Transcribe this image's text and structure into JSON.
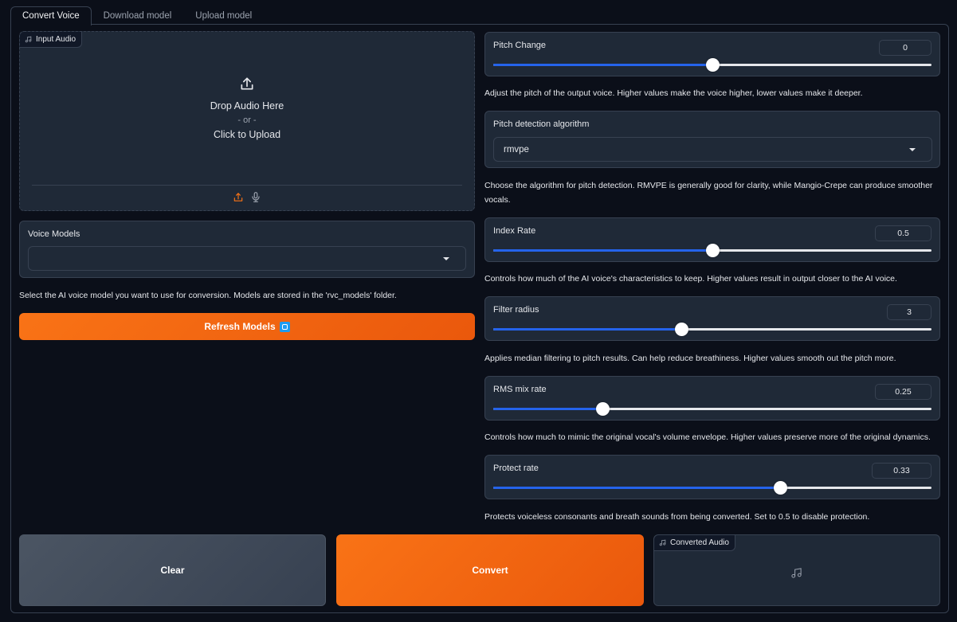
{
  "tabs": [
    {
      "label": "Convert Voice",
      "active": true
    },
    {
      "label": "Download model",
      "active": false
    },
    {
      "label": "Upload model",
      "active": false
    }
  ],
  "input_audio": {
    "label": "Input Audio",
    "label_icon": "music-note-icon",
    "drop_text": "Drop Audio Here",
    "or_text": "- or -",
    "click_text": "Click to Upload",
    "sources": [
      {
        "name": "upload-source",
        "icon": "upload-icon",
        "color": "#f97316"
      },
      {
        "name": "microphone-source",
        "icon": "microphone-icon",
        "color": "#9ca3af"
      }
    ]
  },
  "voice_models": {
    "label": "Voice Models",
    "value": "",
    "info": "Select the AI voice model you want to use for conversion. Models are stored in the 'rvc_models' folder."
  },
  "refresh_button": {
    "label": "Refresh Models",
    "emoji": "repeat-emoji-icon"
  },
  "pitch_change": {
    "label": "Pitch Change",
    "value": "0",
    "fraction": 0.5,
    "info": "Adjust the pitch of the output voice. Higher values make the voice higher, lower values make it deeper."
  },
  "pitch_algorithm": {
    "label": "Pitch detection algorithm",
    "value": "rmvpe",
    "info": "Choose the algorithm for pitch detection. RMVPE is generally good for clarity, while Mangio-Crepe can produce smoother vocals."
  },
  "index_rate": {
    "label": "Index Rate",
    "value": "0.5",
    "fraction": 0.5,
    "info": "Controls how much of the AI voice's characteristics to keep. Higher values result in output closer to the AI voice."
  },
  "filter_radius": {
    "label": "Filter radius",
    "value": "3",
    "fraction": 0.43,
    "info": "Applies median filtering to pitch results. Can help reduce breathiness. Higher values smooth out the pitch more."
  },
  "rms_mix_rate": {
    "label": "RMS mix rate",
    "value": "0.25",
    "fraction": 0.25,
    "info": "Controls how much to mimic the original vocal's volume envelope. Higher values preserve more of the original dynamics."
  },
  "protect_rate": {
    "label": "Protect rate",
    "value": "0.33",
    "fraction": 0.655,
    "info": "Protects voiceless consonants and breath sounds from being converted. Set to 0.5 to disable protection."
  },
  "buttons": {
    "clear": "Clear",
    "convert": "Convert"
  },
  "converted_audio": {
    "label": "Converted Audio",
    "label_icon": "music-note-icon",
    "empty_icon": "music-note-icon"
  },
  "colors": {
    "accent": "#f97316",
    "slider_fill": "#2563eb",
    "panel": "#1f2937",
    "background": "#0b0f19"
  }
}
